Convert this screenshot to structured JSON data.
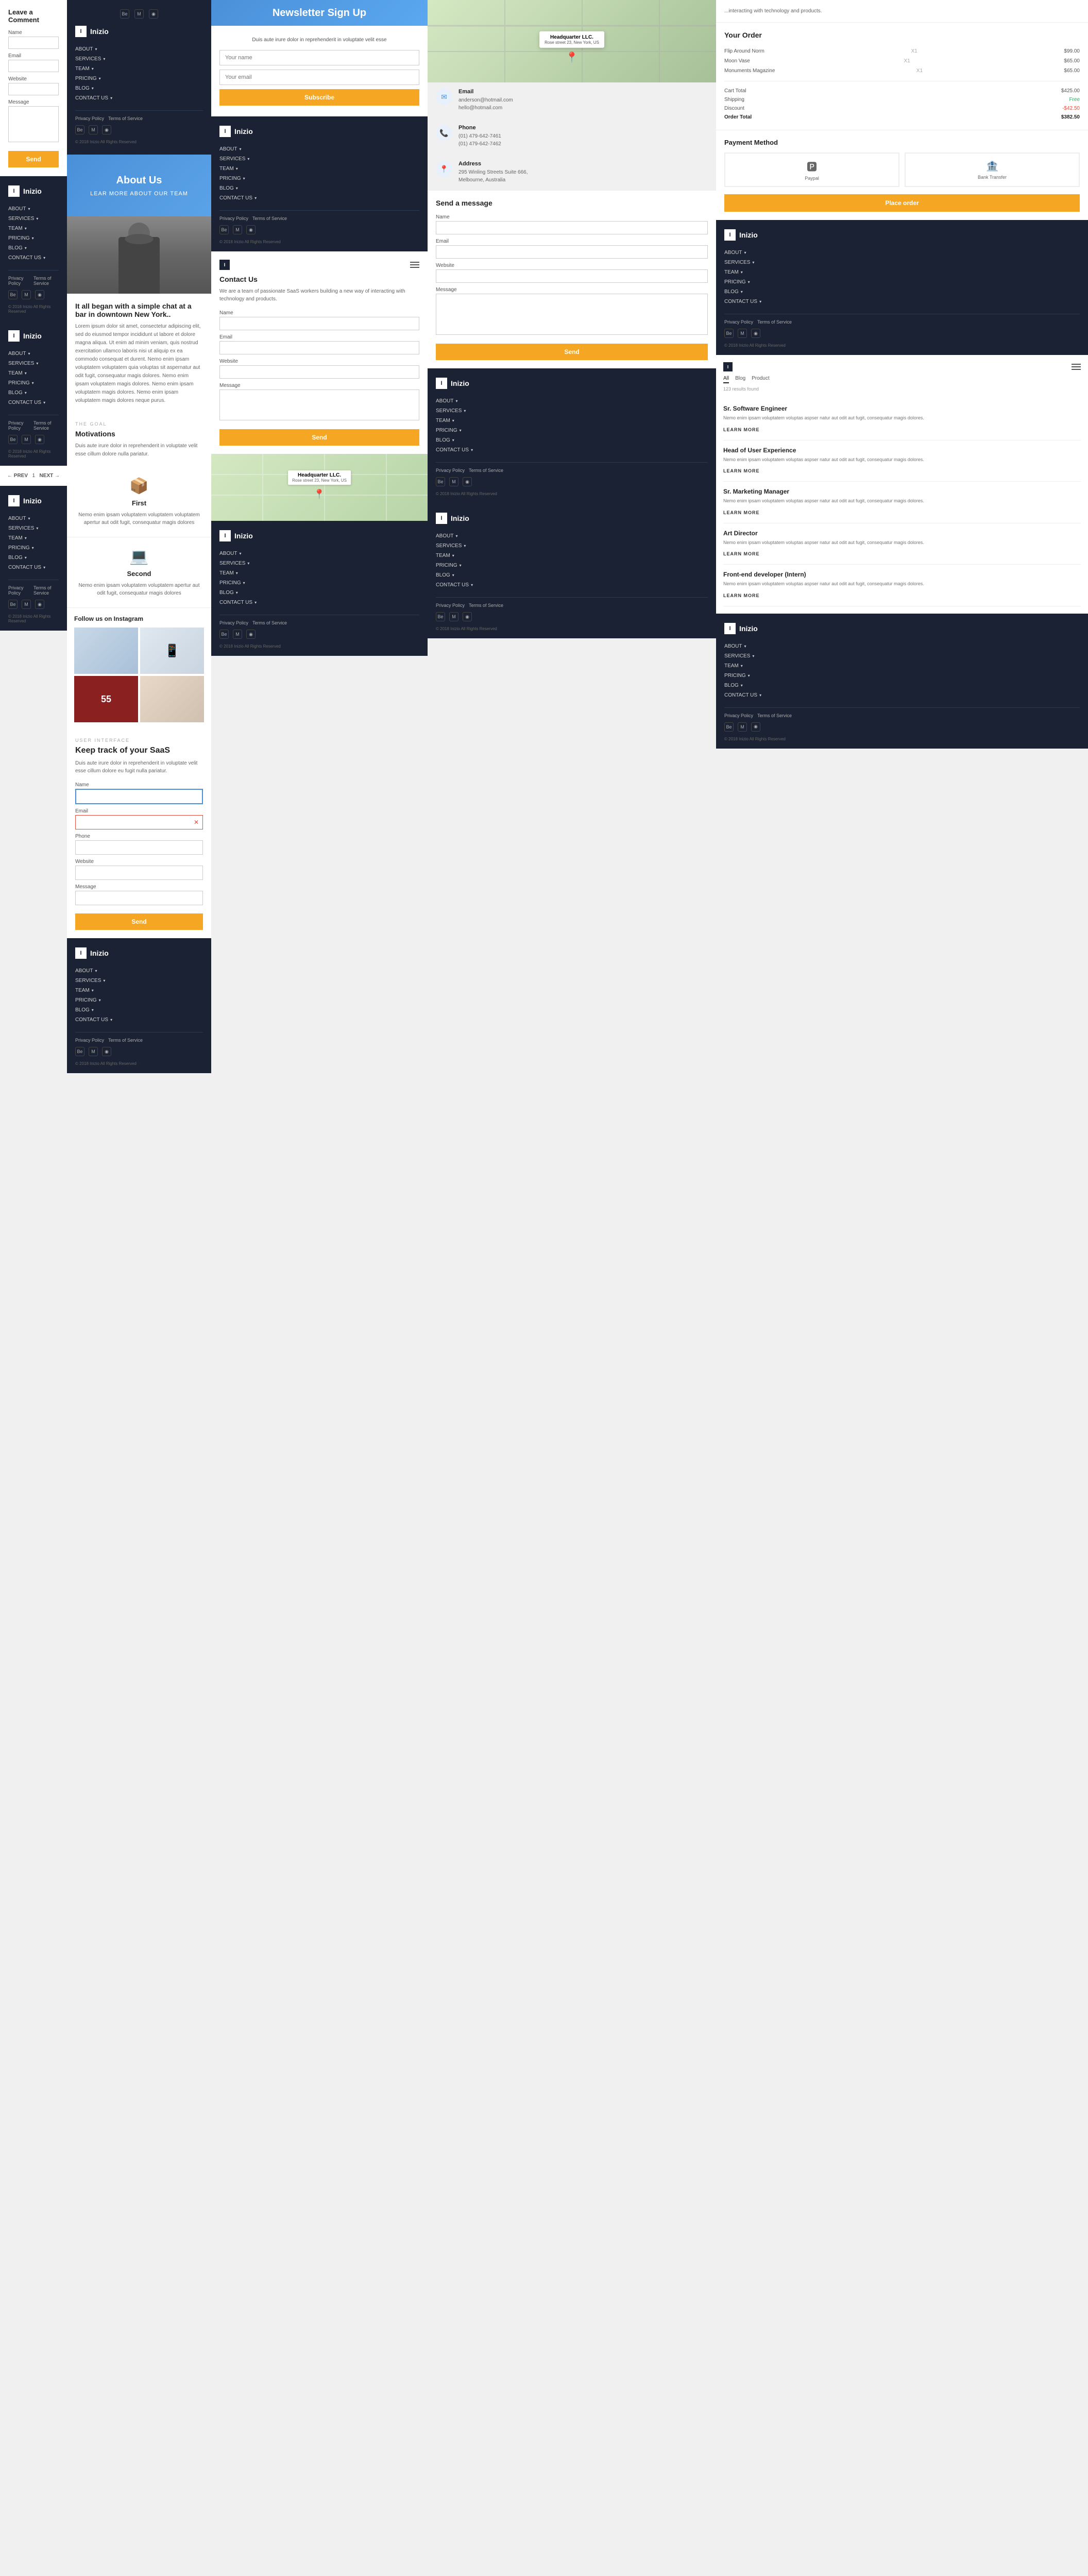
{
  "brand": {
    "name": "Inizio",
    "icon": "I"
  },
  "nav": {
    "about": "ABOUT",
    "services": "SERVICES",
    "team": "TEAM",
    "pricing": "PRICING",
    "blog": "BLOG",
    "contact_us": "CONTACT US",
    "privacy_policy": "Privacy Policy",
    "terms_of_service": "Terms of Service",
    "copyright": "© 2018 Inizio All Rights Reserved"
  },
  "comment": {
    "title": "Leave a Comment",
    "name_label": "Name",
    "email_label": "Email",
    "website_label": "Website",
    "message_label": "Message",
    "send_btn": "Send"
  },
  "newsletter": {
    "title": "Newsletter Sign Up",
    "description": "Duis aute irure dolor in reprehenderit in voluptate velit esse",
    "name_placeholder": "Your name",
    "email_placeholder": "Your email",
    "subscribe_btn": "Subscribe"
  },
  "headquarter": {
    "name": "Headquarter LLC.",
    "address": "Rose street 23, New York, US"
  },
  "about_us": {
    "title": "About Us",
    "subtitle": "LEAR MORE ABOUT OUR TEAM"
  },
  "story": {
    "heading": "It all began with a simple chat at a bar in downtown New York..",
    "body": "Lorem ipsum dolor sit amet, consectetur adipiscing elit, sed do eiusmod tempor incididunt ut labore et dolore magna aliqua. Ut enim ad minim veniam, quis nostrud exercitation ullamco laboris nisi ut aliquip ex ea commodo consequat et durent. Nemo enim ipsam voluptatem voluptatem quia voluptas sit aspernatur aut odit fugit, consequatur magis dolores. Nemo enim ipsam voluptatem magis dolores. Nemo enim ipsam voluptatem magis dolores. Nemo enim ipsam voluptatem magis dolores neque purus."
  },
  "goal": {
    "label": "THE GOAL",
    "title": "Motivations",
    "body": "Duis aute irure dolor in reprehenderit in voluptate velit esse cillum dolore nulla pariatur."
  },
  "features": [
    {
      "icon": "📦",
      "title": "First",
      "description": "Nemo enim ipsam voluptatem voluptatem voluptatem apertur aut odit fugit, consequatur magis dolores"
    },
    {
      "icon": "💻",
      "title": "Second",
      "description": "Nemo enim ipsam voluptatem voluptatem apertur aut odit fugit, consequatur magis dolores"
    }
  ],
  "instagram": {
    "title": "Follow us on Instagram",
    "images": [
      "dark",
      "laptop",
      "red",
      "laptop2",
      "hand"
    ]
  },
  "contact_us_page": {
    "title": "Contact Us",
    "description": "We are a team of passionate SaaS workers building a new way of interacting with technology and products.",
    "name_label": "Name",
    "email_label": "Email",
    "website_label": "Website",
    "message_label": "Message",
    "send_btn": "Send"
  },
  "contact_info": {
    "email": {
      "title": "Email",
      "value1": "anderson@hotmail.com",
      "value2": "hello@hotmail.com"
    },
    "phone": {
      "title": "Phone",
      "value1": "(01) 479-642-7461",
      "value2": "(01) 479-642-7462"
    },
    "address": {
      "title": "Address",
      "value1": "295 Winling Streets Suite 666,",
      "value2": "Melbourne, Australia"
    }
  },
  "send_message": {
    "title": "Send a message",
    "name_label": "Name",
    "email_label": "Email",
    "website_label": "Website",
    "message_label": "Message",
    "send_btn": "Send"
  },
  "order": {
    "title": "Your Order",
    "items": [
      {
        "name": "Flip Around Norm",
        "qty": "X1",
        "price": "$99.00"
      },
      {
        "name": "Moon Vase",
        "qty": "X1",
        "price": "$65.00"
      },
      {
        "name": "Monuments Magazine",
        "qty": "X1",
        "price": "$65.00"
      }
    ],
    "cart_total_label": "Cart Total",
    "cart_total": "$425.00",
    "shipping_label": "Shipping",
    "shipping": "Free",
    "discount_label": "Discount",
    "discount": "-$42.50",
    "order_total_label": "Order Total",
    "order_total": "$382.50"
  },
  "payment": {
    "title": "Payment Method",
    "paypal_label": "Paypal",
    "bank_label": "Bank Transfer",
    "place_order_btn": "Place order"
  },
  "blog": {
    "filter_all": "All",
    "filter_blog": "Blog",
    "filter_product": "Product",
    "results_count": "123 results found",
    "items": [
      {
        "title": "Sr. Software Engineer",
        "body": "Nemo enim ipsam voluptatem voluptas aspser natur aut odit aut fugit, consequatur magis dolores.",
        "learn_more": "LEARN MORE"
      },
      {
        "title": "Head of User Experience",
        "body": "Nemo enim ipsam voluptatem voluptas aspser natur aut odit aut fugit, consequatur magis dolores.",
        "learn_more": "LEARN MORE"
      },
      {
        "title": "Sr. Marketing Manager",
        "body": "Nemo enim ipsam voluptatem voluptas aspser natur aut odit aut fugit, consequatur magis dolores.",
        "learn_more": "LEARN MORE"
      },
      {
        "title": "Art Director",
        "body": "Nemo enim ipsam voluptatem voluptas aspser natur aut odit aut fugit, consequatur magis dolores.",
        "learn_more": "LEARN MORE"
      },
      {
        "title": "Front-end developer (Intern)",
        "body": "Nemo enim ipsam voluptatem voluptas aspser natur aut odit aut fugit, consequatur magis dolores.",
        "learn_more": "LEARN MORE"
      }
    ],
    "prev": "← PREV",
    "next": "NEXT →"
  },
  "keep_track": {
    "label": "USER INTERFACE",
    "title": "Keep track of your SaaS",
    "body": "Duis aute irure dolor in reprehenderit in voluptate velit esse cillum dolore eu fugit nulla pariatur.",
    "name_label": "Name",
    "email_label": "Email",
    "phone_label": "Phone",
    "website_label": "Website",
    "message_label": "Message",
    "send_btn": "Send"
  }
}
